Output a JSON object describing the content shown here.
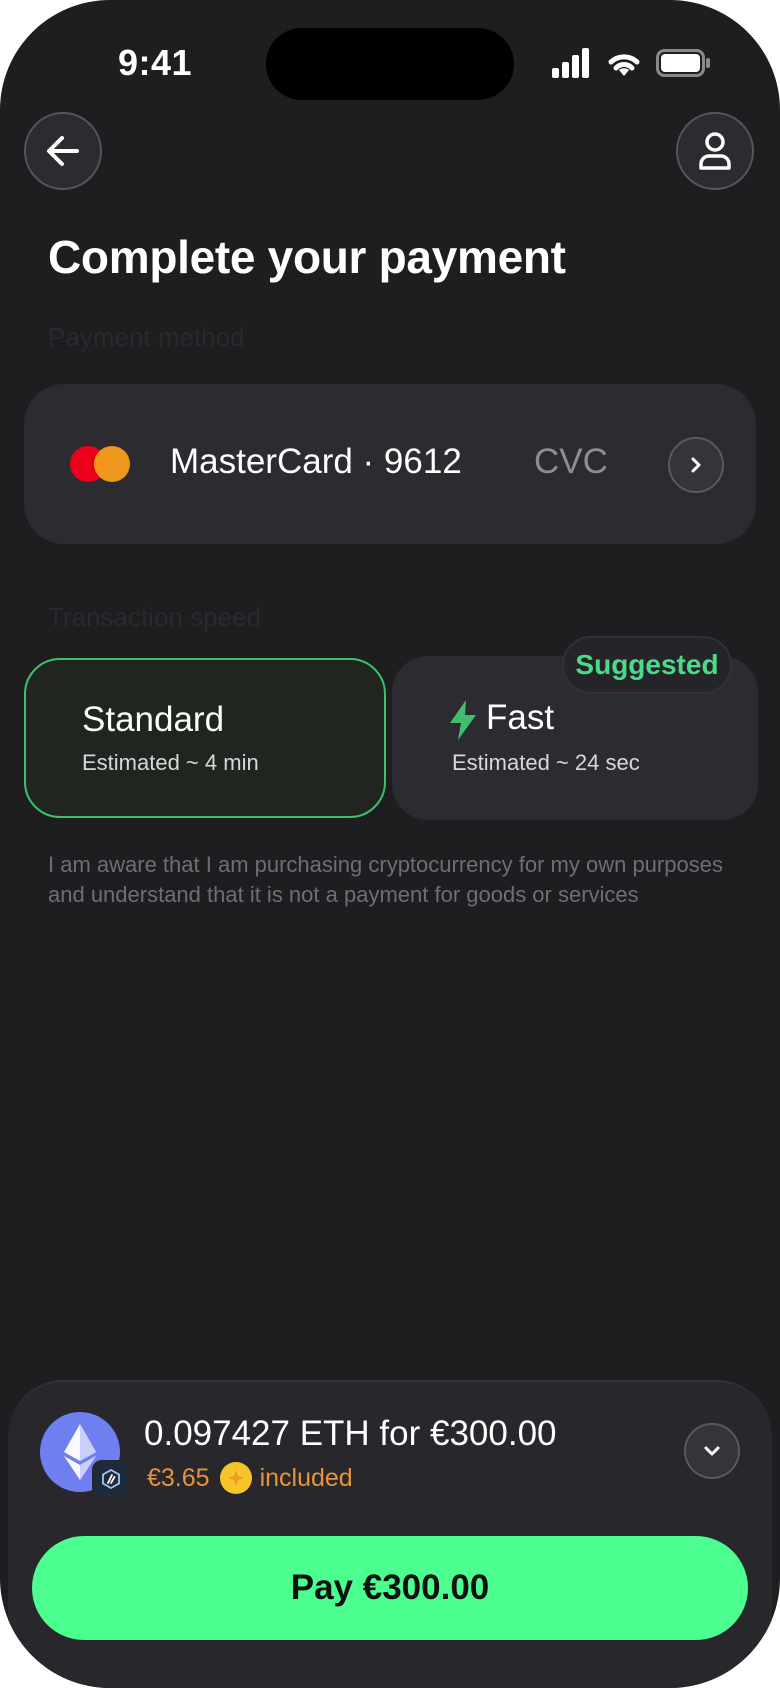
{
  "status_bar": {
    "time": "9:41"
  },
  "header": {
    "back_icon": "arrow-left-icon",
    "profile_icon": "user-icon",
    "title": "Complete your payment"
  },
  "payment_method": {
    "section_label": "Payment method",
    "card_label": "MasterCard · 9612",
    "cvc_label": "CVC",
    "next_icon": "chevron-right-icon"
  },
  "transaction_speed": {
    "section_label": "Transaction speed",
    "options": [
      {
        "name": "Standard",
        "estimate": "Estimated ~ 4 min",
        "selected": true
      },
      {
        "name": "Fast",
        "estimate": "Estimated ~ 24 sec",
        "selected": false,
        "badge": "Suggested",
        "icon": "lightning-icon"
      }
    ]
  },
  "disclaimer": "I am aware that I am purchasing cryptocurrency for my own purposes and understand that it is not a payment for goods or services",
  "summary": {
    "amount_line": "0.097427 ETH for €300.00",
    "fee": "€3.65",
    "fee_suffix": "included",
    "expand_icon": "chevron-down-icon"
  },
  "pay_button": "Pay €300.00",
  "colors": {
    "background": "#1e1d20",
    "card": "#2c2b2f",
    "accent_green": "#4cfe90",
    "selected_border": "#3fbf6d",
    "fee_orange": "#e8923a"
  }
}
